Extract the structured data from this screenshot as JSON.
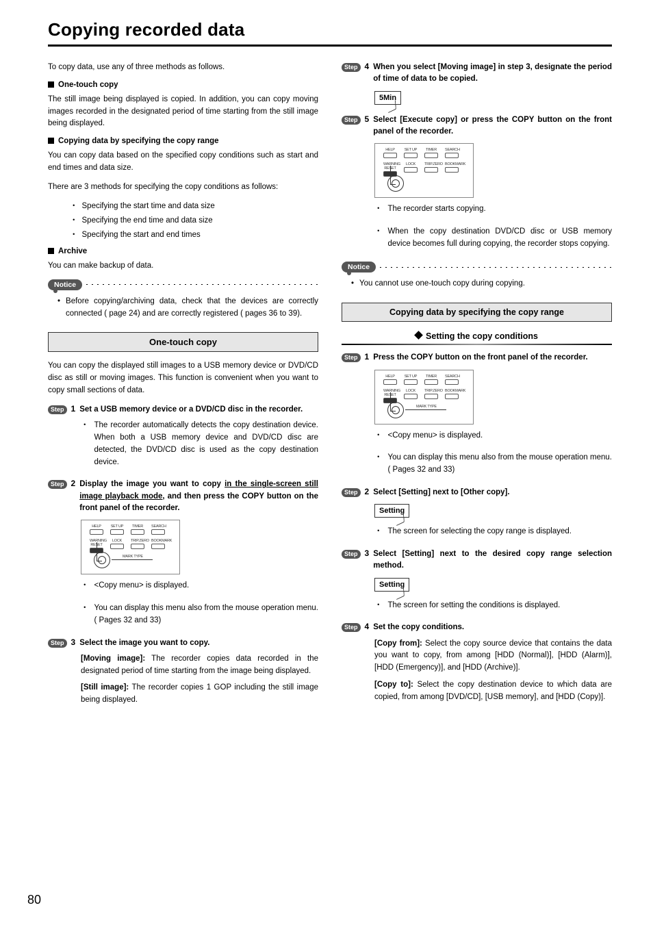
{
  "page": {
    "title": "Copying recorded data",
    "number": "80"
  },
  "left": {
    "intro": "To copy data, use any of three methods as follows.",
    "onetouch_head": "One-touch copy",
    "onetouch_body": "The still image being displayed is copied. In addition, you can copy moving images recorded in the designated period of time starting from the still image being displayed.",
    "copyrange_head": "Copying data by specifying the copy range",
    "copyrange_body1": "You can copy data based on the specified copy conditions such as start and end times and data size.",
    "copyrange_body2": "There are 3 methods for specifying the copy conditions as follows:",
    "copyrange_items": [
      "Specifying the start time and data size",
      "Specifying the end time and data size",
      "Specifying the start and end times"
    ],
    "archive_head": "Archive",
    "archive_body": "You can make backup of data.",
    "notice1": "Before copying/archiving data, check that the devices are correctly connected (      page 24) and are correctly registered (      pages 36 to 39).",
    "section_onetouch": "One-touch copy",
    "onetouch_desc": "You can copy the displayed still images to a USB memory device or DVD/CD disc as still or moving images. This function is convenient when you want to copy small sections of data.",
    "step1": "Set a USB memory device or a DVD/CD disc in the recorder.",
    "step1_body": "The recorder automatically detects the copy destination device. When both a USB memory device and DVD/CD disc are detected, the DVD/CD disc is used as the copy destination device.",
    "step2_a": "Display the image you want to copy ",
    "step2_b": "in the single-screen still image playback mode",
    "step2_c": ", and then press the COPY button on the front panel of the recorder.",
    "step2_body1": "<Copy menu> is displayed.",
    "step2_body2": "You can display this menu also from the mouse operation menu. (      Pages 32 and 33)",
    "step3": "Select the image you want to copy.",
    "step3_body_moving_label": "[Moving image]:",
    "step3_body_moving": " The recorder copies data recorded in the designated period of time starting from the image being displayed.",
    "step3_body_still_label": "[Still image]:",
    "step3_body_still": " The recorder copies 1 GOP including the still image being displayed.",
    "panel_a": {
      "labels": [
        "HELP",
        "SET UP",
        "TIMER",
        "SEARCH"
      ],
      "labels2": [
        "WARNING RESET",
        "LOCK",
        "TRIP.ZERO",
        "BOOKMARK"
      ],
      "mark": "MARK TYPE"
    }
  },
  "right": {
    "step4": "When you select [Moving image] in step 3, designate the period of time of data to be copied.",
    "box_5min": "5Min",
    "step5": "Select [Execute copy] or press the COPY button on the front panel of the recorder.",
    "step5_body1": "The recorder starts copying.",
    "step5_body2": "When the copy destination DVD/CD disc or USB memory device becomes full during copying, the recorder stops copying.",
    "notice2": "You cannot use one-touch copy during copying.",
    "section_copyrange": "Copying data by specifying the copy range",
    "subsection_setting": "Setting the copy conditions",
    "r_step1": "Press the COPY button on the front panel of the recorder.",
    "r_step1_body1": "<Copy menu> is displayed.",
    "r_step1_body2": "You can display this menu also from the mouse operation menu. (      Pages 32 and 33)",
    "r_step2": "Select [Setting] next to [Other copy].",
    "box_setting": "Setting",
    "r_step2_body": "The screen for selecting the copy range is displayed.",
    "r_step3": "Select [Setting] next to the desired copy range selection method.",
    "r_step3_body": "The screen for setting the conditions is displayed.",
    "r_step4": "Set the copy conditions.",
    "r_step4_from_label": "[Copy from]:",
    "r_step4_from": " Select the copy source device that contains the data you want to copy, from among [HDD (Normal)], [HDD (Alarm)], [HDD (Emergency)], and [HDD (Archive)].",
    "r_step4_to_label": "[Copy to]:",
    "r_step4_to": " Select the copy destination device to which data are copied, from among [DVD/CD], [USB memory], and [HDD (Copy)].",
    "panel_b": {
      "labels": [
        "HELP",
        "SET UP",
        "TIMER",
        "SEARCH"
      ],
      "labels2": [
        "WARNING RESET",
        "LOCK",
        "TRIP.ZERO",
        "BOOKMARK"
      ]
    }
  },
  "labels": {
    "notice": "Notice",
    "step": "Step",
    "nums": [
      "1",
      "2",
      "3",
      "4",
      "5"
    ]
  }
}
